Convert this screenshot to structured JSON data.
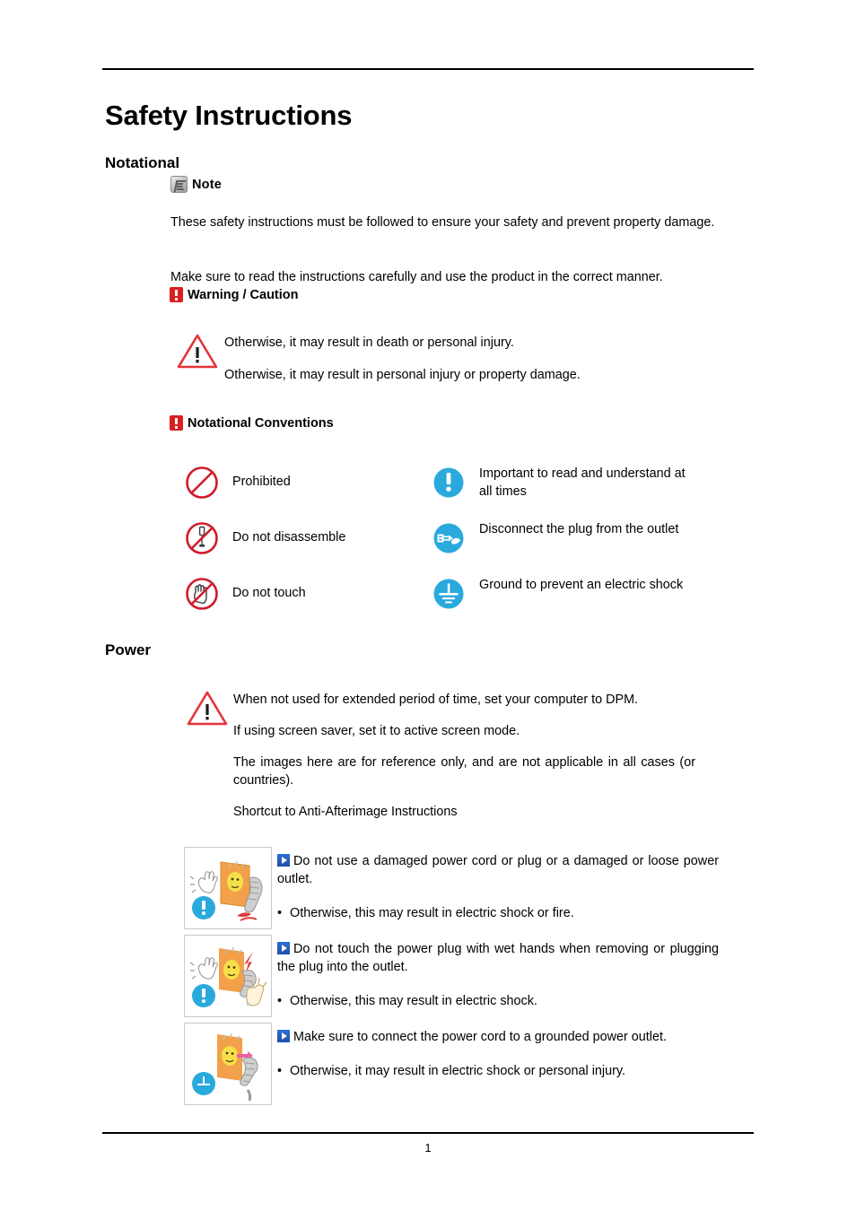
{
  "document": {
    "title": "Safety Instructions",
    "page_number": "1"
  },
  "sections": {
    "notational": {
      "heading": "Notational",
      "note_label": "Note",
      "note_icon": "note-pencil-icon",
      "paragraph_1": "These safety instructions must be followed to ensure your safety and prevent property damage.",
      "paragraph_2": "Make sure to read the instructions carefully and use the product in the correct manner.",
      "warning_caution_label": "Warning / Caution",
      "warning_lines": [
        "Otherwise, it may result in death or personal injury.",
        "Otherwise, it may result in personal injury or property damage."
      ],
      "conventions_label": "Notational Conventions",
      "conventions": {
        "left": [
          {
            "icon": "prohibited-icon",
            "label": "Prohibited"
          },
          {
            "icon": "do-not-disassemble-icon",
            "label": "Do not disassemble"
          },
          {
            "icon": "do-not-touch-icon",
            "label": "Do not touch"
          }
        ],
        "right": [
          {
            "icon": "important-exclamation-icon",
            "label": "Important to read and understand at all times"
          },
          {
            "icon": "disconnect-plug-icon",
            "label": "Disconnect the plug from the outlet"
          },
          {
            "icon": "ground-icon",
            "label": "Ground to prevent an electric shock"
          }
        ]
      }
    },
    "power": {
      "heading": "Power",
      "lines": [
        "When not used for extended period of time, set your computer to DPM.",
        "If using screen saver, set it to active screen mode.",
        "The images here are for reference only, and are not applicable in all cases (or countries).",
        "Shortcut to Anti-Afterimage Instructions"
      ],
      "warnings": [
        {
          "thumb_icon": "damaged-power-cord-illustration",
          "badge": "important-exclamation-icon",
          "lead": "Do not use a damaged power cord or plug or a damaged or loose power outlet.",
          "sub": "Otherwise, this may result in electric shock or fire."
        },
        {
          "thumb_icon": "wet-hands-plug-illustration",
          "badge": "important-exclamation-icon",
          "lead": "Do not touch the power plug with wet hands when removing or plugging the plug into the outlet.",
          "sub": "Otherwise, this may result in electric shock."
        },
        {
          "thumb_icon": "grounded-outlet-illustration",
          "badge": "ground-icon",
          "lead": "Make sure to connect the power cord to a grounded power outlet.",
          "sub": "Otherwise, it may result in electric shock or personal injury."
        }
      ]
    }
  },
  "colors": {
    "warning_red": "#d81f22",
    "notice_blue": "#2aa9dd",
    "arrow_blue": "#2f6fd4",
    "rule_black": "#000000"
  }
}
